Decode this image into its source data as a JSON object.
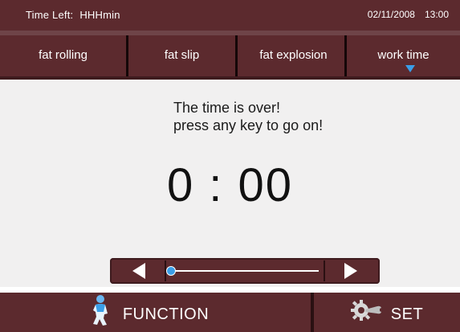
{
  "status": {
    "time_left_label": "Time Left:",
    "time_left_value": "HHHmin",
    "date": "02/11/2008",
    "time": "13:00"
  },
  "tabs": [
    {
      "label": "fat rolling"
    },
    {
      "label": "fat slip"
    },
    {
      "label": "fat explosion"
    },
    {
      "label": "work time",
      "selected": true
    }
  ],
  "main": {
    "message_line1": "The time is over!",
    "message_line2": "press any key to go on!",
    "timer": "0 : 00"
  },
  "slider": {
    "position": 0.0
  },
  "bottom": {
    "function_label": "FUNCTION",
    "set_label": "SET"
  },
  "icons": {
    "function": "person-icon",
    "set": "gear-wrench-icon"
  },
  "colors": {
    "bar": "#5c2a2e",
    "accent": "#3a9ee8",
    "content_bg": "#f1f0f0"
  }
}
